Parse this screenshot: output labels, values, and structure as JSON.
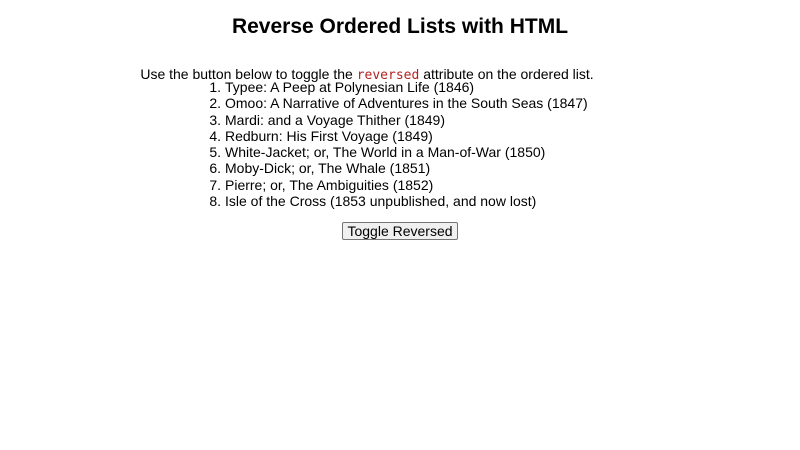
{
  "page": {
    "title": "Reverse Ordered Lists with HTML",
    "intro_before": "Use the button below to toggle the ",
    "intro_code": "reversed",
    "intro_after": " attribute on the ordered list."
  },
  "list": {
    "items": [
      {
        "num": "1.",
        "text": "Typee: A Peep at Polynesian Life (1846)"
      },
      {
        "num": "2.",
        "text": "Omoo: A Narrative of Adventures in the South Seas (1847)"
      },
      {
        "num": "3.",
        "text": "Mardi: and a Voyage Thither (1849)"
      },
      {
        "num": "4.",
        "text": "Redburn: His First Voyage (1849)"
      },
      {
        "num": "5.",
        "text": "White-Jacket; or, The World in a Man-of-War (1850)"
      },
      {
        "num": "6.",
        "text": "Moby-Dick; or, The Whale (1851)"
      },
      {
        "num": "7.",
        "text": "Pierre; or, The Ambiguities (1852)"
      },
      {
        "num": "8.",
        "text": "Isle of the Cross (1853 unpublished, and now lost)"
      }
    ]
  },
  "toggle": {
    "label": "Toggle Reversed"
  },
  "colors": {
    "code_text": "#b22222"
  }
}
